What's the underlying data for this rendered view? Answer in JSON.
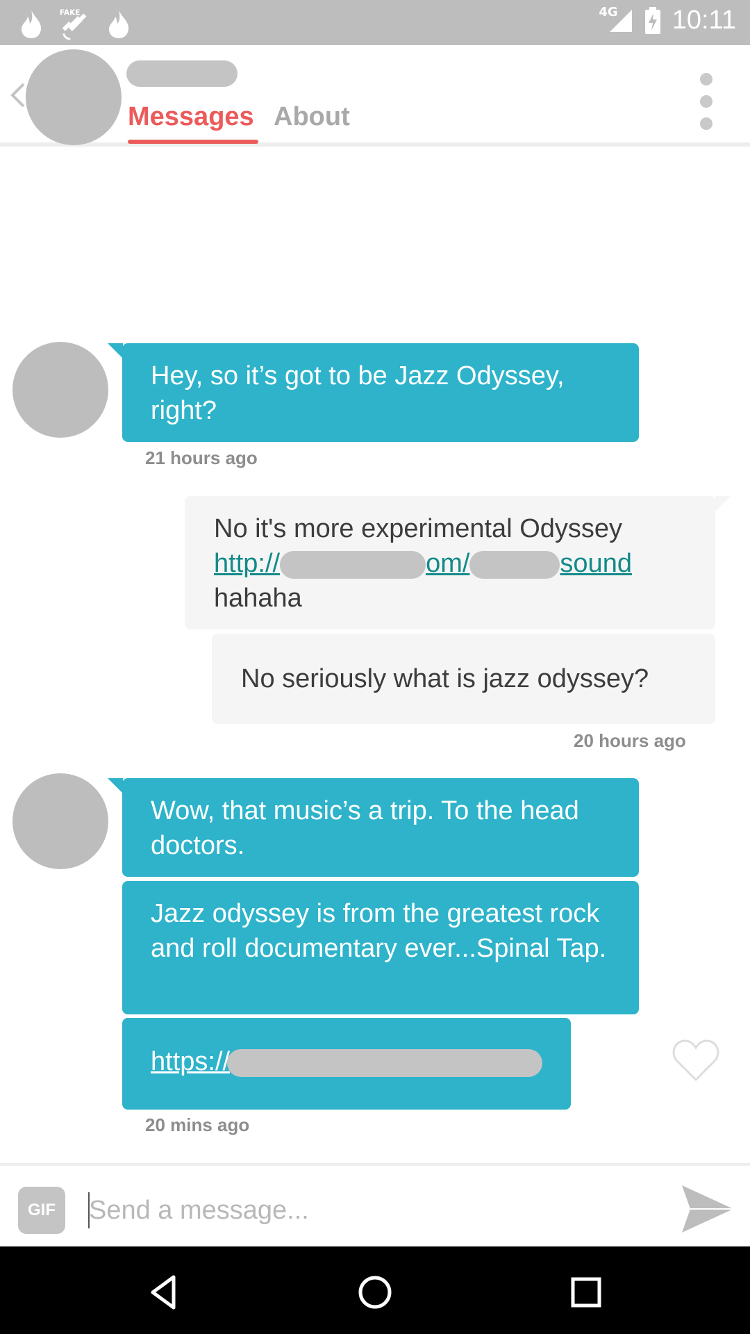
{
  "status_bar": {
    "time": "10:11",
    "network": "4G",
    "left_icons": [
      "flame-icon",
      "fake-gps-icon",
      "flame-icon"
    ],
    "right_icons": [
      "signal-icon",
      "battery-charging-icon"
    ]
  },
  "header": {
    "tabs": [
      {
        "label": "Messages",
        "active": true
      },
      {
        "label": "About",
        "active": false
      }
    ],
    "accent_color": "#ec5b5b"
  },
  "messages": {
    "m1": {
      "text": "Hey, so it’s got to be Jazz Odyssey, right?",
      "time": "21 hours ago"
    },
    "m2": {
      "line1": "No it's more experimental Odyssey",
      "link_start": "http://",
      "link_mid": "om/",
      "link_end": "sound",
      "line3": "hahaha"
    },
    "m3": {
      "text": "No seriously what is jazz odyssey?",
      "time": "20 hours ago"
    },
    "m4": {
      "text": "Wow, that music’s a trip. To the head doctors."
    },
    "m5": {
      "text": "Jazz odyssey is from the greatest rock and roll documentary ever...Spinal Tap."
    },
    "m6": {
      "link_start": "https://",
      "time": "20 mins ago"
    },
    "bubble_color_incoming": "#2eb3ca",
    "bubble_color_outgoing": "#f5f5f5"
  },
  "composer": {
    "gif_label": "GIF",
    "placeholder": "Send a message..."
  },
  "nav_bar": {
    "buttons": [
      "back-triangle-icon",
      "home-circle-icon",
      "recents-square-icon"
    ]
  }
}
